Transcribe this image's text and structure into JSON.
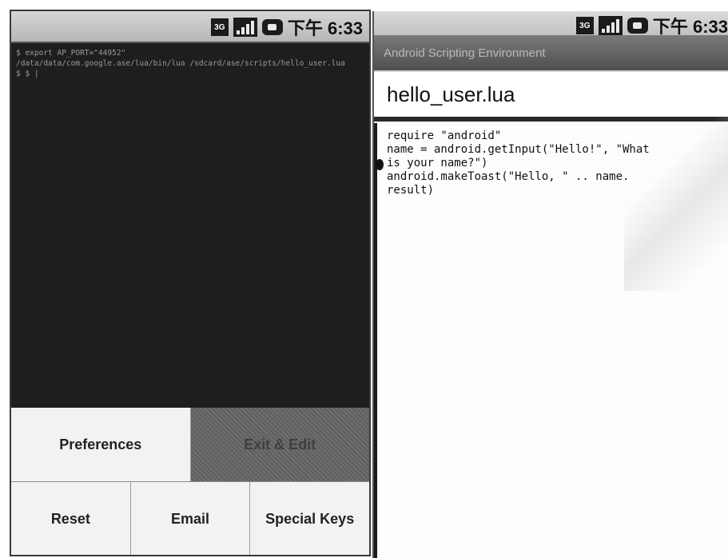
{
  "left_screen": {
    "status_bar": {
      "network_icon": "3g-icon",
      "network_label": "3G",
      "signal_icon": "signal-icon",
      "battery_icon": "battery-icon",
      "time": "下午 6:33"
    },
    "terminal": {
      "lines": [
        "$ export AP_PORT=\"44952\"",
        "/data/data/com.google.ase/lua/bin/lua /sdcard/ase/scripts/hello_user.lua",
        "$ $ |"
      ]
    },
    "menu": {
      "top_row": [
        {
          "label": "Preferences",
          "state": "enabled"
        },
        {
          "label": "Exit & Edit",
          "state": "disabled"
        }
      ],
      "bottom_row": [
        {
          "label": "Reset"
        },
        {
          "label": "Email"
        },
        {
          "label": "Special Keys"
        }
      ]
    }
  },
  "right_screen": {
    "status_bar": {
      "network_icon": "3g-icon",
      "network_label": "3G",
      "signal_icon": "signal-icon",
      "battery_icon": "battery-icon",
      "time": "下午 6:33"
    },
    "title_bar": "Android Scripting Environment",
    "filename": "hello_user.lua",
    "editor": {
      "lines": [
        "require \"android\"",
        "name = android.getInput(\"Hello!\", \"What",
        "is your name?\")",
        "android.makeToast(\"Hello, \" .. name.",
        "result)"
      ]
    }
  }
}
